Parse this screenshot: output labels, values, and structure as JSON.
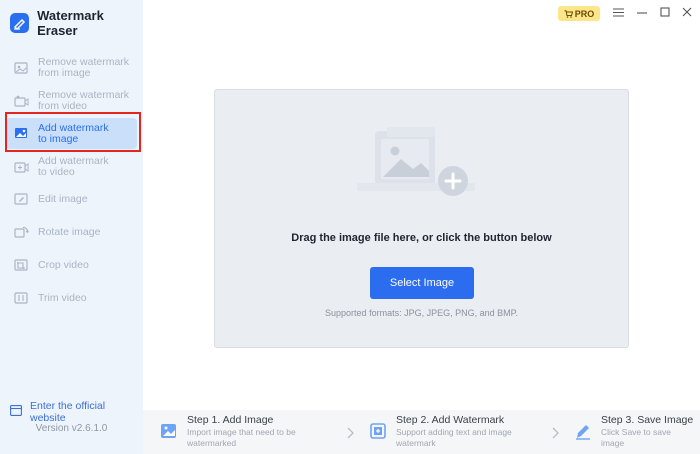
{
  "app": {
    "title": "Watermark Eraser",
    "version": "Version v2.6.1.0"
  },
  "sidebar": {
    "items": [
      {
        "label": "Remove watermark\nfrom image",
        "icon": "image-eraser-icon",
        "active": false
      },
      {
        "label": "Remove watermark\nfrom video",
        "icon": "video-eraser-icon",
        "active": false
      },
      {
        "label": "Add watermark\nto image",
        "icon": "image-add-icon",
        "active": true
      },
      {
        "label": "Add watermark\nto video",
        "icon": "video-add-icon",
        "active": false
      },
      {
        "label": "Edit image",
        "icon": "edit-image-icon",
        "active": false
      },
      {
        "label": "Rotate image",
        "icon": "rotate-image-icon",
        "active": false
      },
      {
        "label": "Crop video",
        "icon": "crop-video-icon",
        "active": false
      },
      {
        "label": "Trim video",
        "icon": "trim-video-icon",
        "active": false
      }
    ],
    "official_link": "Enter the official website"
  },
  "topbar": {
    "pro_label": "PRO"
  },
  "dropzone": {
    "instruction": "Drag the image file here, or click the button below",
    "button_label": "Select Image",
    "formats": "Supported formats: JPG, JPEG, PNG, and BMP."
  },
  "steps": [
    {
      "title": "Step 1. Add Image",
      "desc": "Import image that need to be\nwatermarked",
      "icon": "add-image-step-icon"
    },
    {
      "title": "Step 2. Add Watermark",
      "desc": "Support adding text and image\nwatermark",
      "icon": "add-watermark-step-icon"
    },
    {
      "title": "Step 3. Save Image",
      "desc": "Click Save to save\nimage",
      "icon": "save-image-step-icon"
    }
  ],
  "colors": {
    "accent": "#2c6df0",
    "sidebar_bg": "#eef4fc",
    "active_bg": "#c9dffa",
    "highlight": "#e3261f",
    "pro_bg": "#fde68a"
  }
}
